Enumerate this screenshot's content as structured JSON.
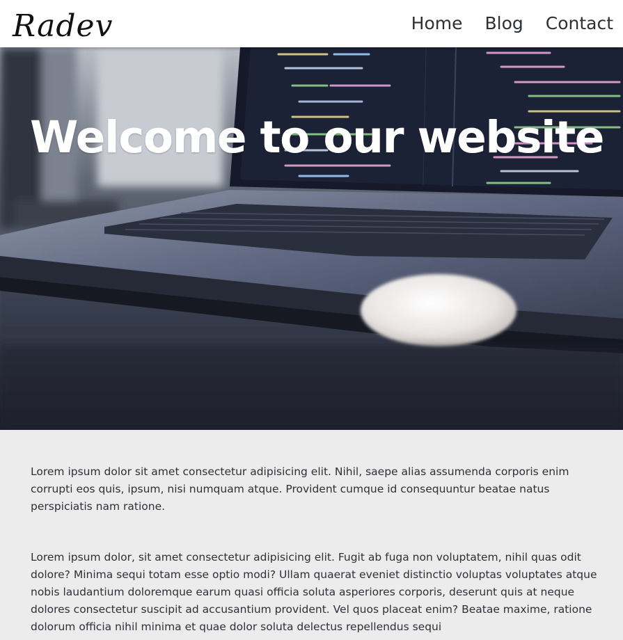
{
  "brand": {
    "logo_text": "Radev"
  },
  "nav": {
    "items": [
      {
        "label": "Home"
      },
      {
        "label": "Blog"
      },
      {
        "label": "Contact"
      }
    ]
  },
  "hero": {
    "title": "Welcome to our website",
    "image_subject": "laptop with code editor and mouse"
  },
  "content": {
    "paragraphs": [
      "Lorem ipsum dolor sit amet consectetur adipisicing elit. Nihil, saepe alias assumenda corporis enim corrupti eos quis, ipsum, nisi numquam atque. Provident cumque id consequuntur beatae natus perspiciatis nam ratione.",
      "Lorem ipsum dolor, sit amet consectetur adipisicing elit. Fugit ab fuga non voluptatem, nihil quas odit dolore? Minima sequi totam esse optio modi? Ullam quaerat eveniet distinctio voluptas voluptates atque nobis laudantium doloremque earum quasi officia soluta asperiores corporis, deserunt quis at neque dolores consectetur suscipit ad accusantium provident. Vel quos placeat enim? Beatae maxime, ratione dolorum officia nihil minima et quae dolor soluta delectus repellendus sequi"
    ]
  },
  "colors": {
    "navbar_bg": "#ffffff",
    "nav_text": "#2c3138",
    "page_bg": "#ececec",
    "body_text": "#2d3036",
    "hero_title": "#ffffff"
  }
}
